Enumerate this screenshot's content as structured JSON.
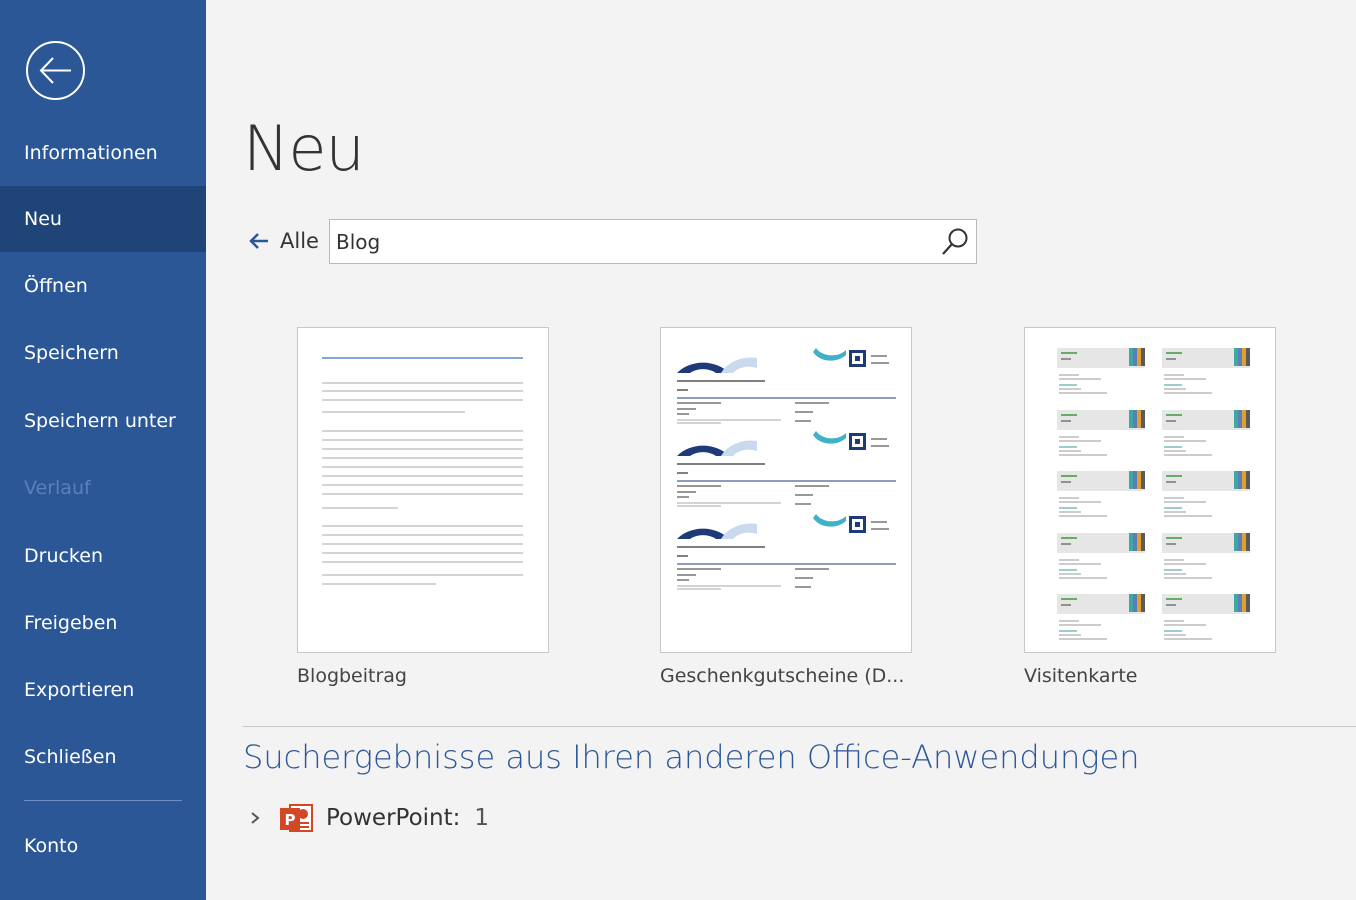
{
  "sidebar": {
    "items": [
      {
        "label": "Informationen"
      },
      {
        "label": "Neu"
      },
      {
        "label": "Öffnen"
      },
      {
        "label": "Speichern"
      },
      {
        "label": "Speichern unter"
      },
      {
        "label": "Verlauf"
      },
      {
        "label": "Drucken"
      },
      {
        "label": "Freigeben"
      },
      {
        "label": "Exportieren"
      },
      {
        "label": "Schließen"
      },
      {
        "label": "Konto"
      }
    ],
    "active": "Neu",
    "disabled": "Verlauf"
  },
  "main": {
    "title": "Neu",
    "back_label": "Alle",
    "search": {
      "value": "Blog"
    },
    "templates": [
      {
        "name": "Blogbeitrag"
      },
      {
        "name": "Geschenkgutscheine (D..."
      },
      {
        "name": "Visitenkarte"
      }
    ],
    "results_title": "Suchergebnisse aus Ihren anderen Office-Anwendungen",
    "other_apps": [
      {
        "app": "PowerPoint:",
        "count": "1"
      }
    ]
  },
  "colors": {
    "sidebar": "#2b5797",
    "sidebar_active": "#1f4478",
    "accent": "#2b5797",
    "powerpoint": "#d24726"
  }
}
